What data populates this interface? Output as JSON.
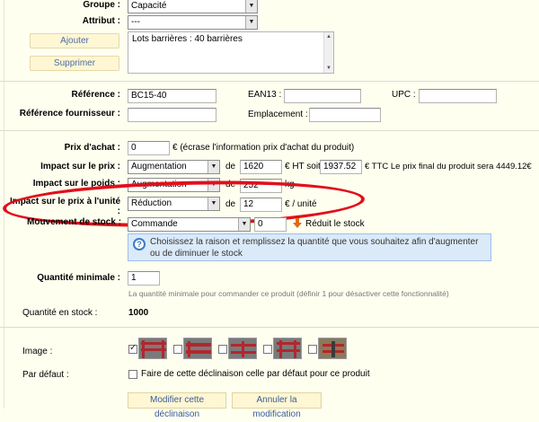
{
  "attributes": {
    "groupe_label": "Groupe :",
    "groupe_value": "Capacité",
    "attribut_label": "Attribut :",
    "attribut_value": "---",
    "add_button": "Ajouter",
    "remove_button": "Supprimer",
    "list_items": [
      "Lots barrières : 40 barrières"
    ]
  },
  "references": {
    "reference_label": "Référence :",
    "reference_value": "BC15-40",
    "ean13_label": "EAN13 :",
    "ean13_value": "",
    "upc_label": "UPC :",
    "upc_value": "",
    "supplier_ref_label": "Référence fournisseur :",
    "supplier_ref_value": "",
    "location_label": "Emplacement :",
    "location_value": ""
  },
  "prices": {
    "purchase_label": "Prix d'achat :",
    "purchase_value": "0",
    "purchase_note": "€ (écrase l'information prix d'achat du produit)",
    "impact_price_label": "Impact sur le prix :",
    "impact_price_select": "Augmentation",
    "impact_price_de": "de",
    "impact_price_value": "1620",
    "ht_soit": "€ HT soit",
    "ttc_value": "1937.52",
    "ttc_note": "€ TTC Le prix final du produit sera 4449.12€",
    "impact_weight_label": "Impact sur le poids :",
    "impact_weight_select": "Augmentation",
    "impact_weight_de": "de",
    "impact_weight_value": "252",
    "weight_unit": "kg",
    "impact_unit_label": "Impact sur le prix à l'unité",
    "impact_unit_colon": ":",
    "impact_unit_select": "Réduction",
    "impact_unit_de": "de",
    "impact_unit_value": "12",
    "impact_unit_suffix": "€ / unité"
  },
  "stock": {
    "movement_label": "Mouvement de stock :",
    "movement_select": "Commande",
    "movement_value": "0",
    "movement_action": "Réduit le stock",
    "info_text": "Choisissez la raison et remplissez la quantité que vous souhaitez afin d'augmenter ou de diminuer le stock",
    "min_qty_label": "Quantité minimale :",
    "min_qty_value": "1",
    "min_qty_hint": "La quantité minimale pour commander ce produit (définir 1 pour désactiver cette fonctionnalité)",
    "stock_qty_label": "Quantité en stock :",
    "stock_qty_value": "1000"
  },
  "images": {
    "label": "Image :",
    "thumbnails": [
      {
        "checked": true
      },
      {
        "checked": false
      },
      {
        "checked": false
      },
      {
        "checked": false
      },
      {
        "checked": false
      }
    ]
  },
  "default": {
    "label": "Par défaut :",
    "checkbox_label": "Faire de cette déclinaison celle par défaut pour ce produit",
    "checked": false
  },
  "actions": {
    "modify_button": "Modifier cette déclinaison",
    "cancel_button": "Annuler la modification"
  },
  "colors": {
    "background": "#fffff0",
    "highlight_ellipse": "#e0101b",
    "info_box": "#dbeaf9",
    "button_bg": "#fff6d3"
  }
}
